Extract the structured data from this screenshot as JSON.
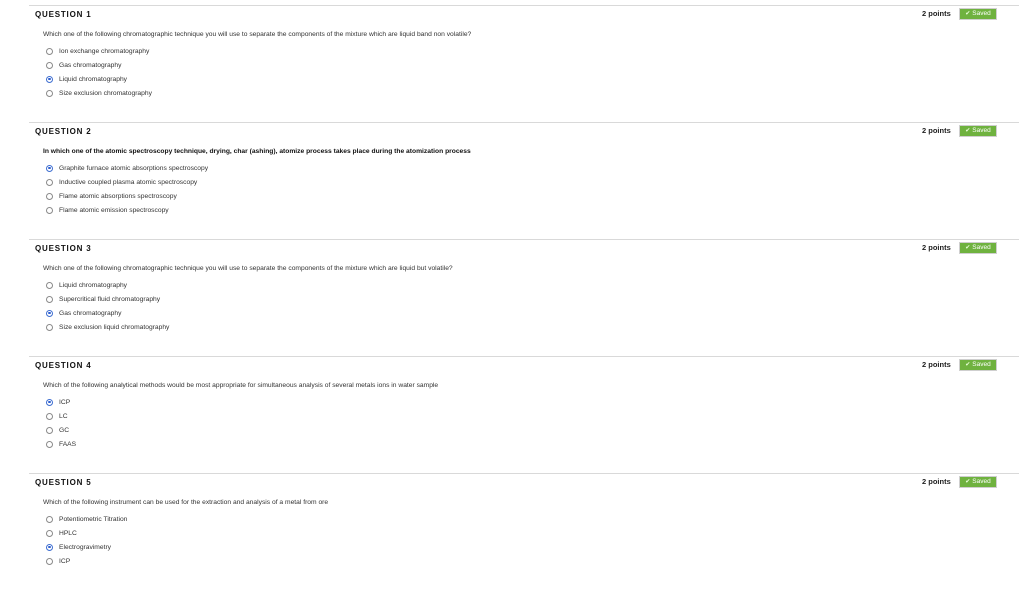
{
  "questions": [
    {
      "title": "QUESTION 1",
      "points": "2 points",
      "status": "Saved",
      "text": "Which one of the following chromatographic technique you will use to separate the components of the mixture which are liquid band non volatile?",
      "options": [
        {
          "label": "Ion exchange chromatography",
          "selected": false
        },
        {
          "label": "Gas chromatography",
          "selected": false
        },
        {
          "label": "Liquid chromatography",
          "selected": true
        },
        {
          "label": "Size exclusion chromatography",
          "selected": false
        }
      ]
    },
    {
      "title": "QUESTION 2",
      "points": "2 points",
      "status": "Saved",
      "text": "In which one of the atomic spectroscopy technique, drying, char (ashing), atomize process takes place during the atomization process",
      "options": [
        {
          "label": "Graphite furnace atomic absorptions spectroscopy",
          "selected": true
        },
        {
          "label": "Inductive coupled plasma atomic spectroscopy",
          "selected": false
        },
        {
          "label": "Flame atomic absorptions spectroscopy",
          "selected": false
        },
        {
          "label": "Flame atomic emission spectroscopy",
          "selected": false
        }
      ]
    },
    {
      "title": "QUESTION 3",
      "points": "2 points",
      "status": "Saved",
      "text": "Which one of the following chromatographic technique you will use to separate the components of the mixture which are liquid but volatile?",
      "options": [
        {
          "label": "Liquid chromatography",
          "selected": false
        },
        {
          "label": "Supercritical fluid chromatography",
          "selected": false
        },
        {
          "label": "Gas chromatography",
          "selected": true
        },
        {
          "label": "Size exclusion liquid chromatography",
          "selected": false
        }
      ]
    },
    {
      "title": "QUESTION 4",
      "points": "2 points",
      "status": "Saved",
      "text": "Which of the following analytical methods would be most appropriate for simultaneous analysis of several metals ions in water sample",
      "options": [
        {
          "label": "ICP",
          "selected": true
        },
        {
          "label": "LC",
          "selected": false
        },
        {
          "label": "GC",
          "selected": false
        },
        {
          "label": "FAAS",
          "selected": false
        }
      ]
    },
    {
      "title": "QUESTION 5",
      "points": "2 points",
      "status": "Saved",
      "text": "Which of the following instrument can be used for the extraction and analysis of a metal from ore",
      "options": [
        {
          "label": "Potentiometric Titration",
          "selected": false
        },
        {
          "label": "HPLC",
          "selected": false
        },
        {
          "label": "Electrogravimetry",
          "selected": true
        },
        {
          "label": "ICP",
          "selected": false
        }
      ]
    }
  ]
}
